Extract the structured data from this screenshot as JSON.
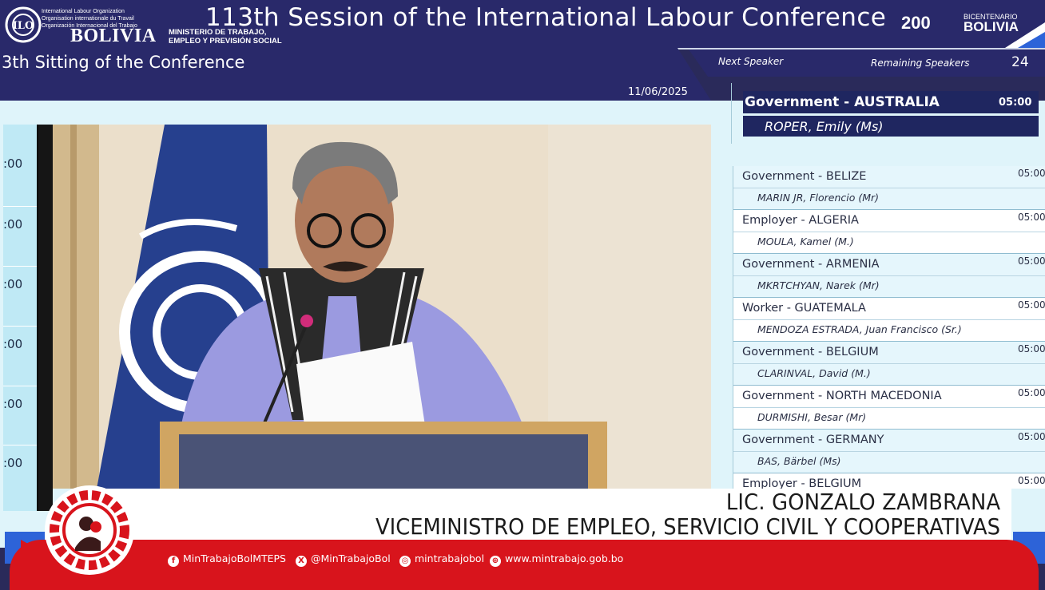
{
  "header": {
    "ilo_lines": [
      "International Labour Organization",
      "Organisation internationale du Travail",
      "Organización Internacional del Trabajo"
    ],
    "country_word": "BOLIVIA",
    "ministry_lines": [
      "MINISTERIO DE TRABAJO,",
      "EMPLEO Y PREVISIÓN SOCIAL"
    ],
    "conference_title": "113th Session of the International Labour Conference",
    "bicentenario_number": "200",
    "bicentenario_small": "BICENTENARIO",
    "bicentenario_big": "BOLIVIA"
  },
  "sitting": {
    "title": "3th Sitting of the Conference",
    "date": "11/06/2025"
  },
  "speakers_panel": {
    "next_label": "Next Speaker",
    "remaining_label": "Remaining Speakers",
    "remaining_count": "24",
    "next": {
      "country": "Government - AUSTRALIA",
      "time": "05:00",
      "name": "ROPER, Emily (Ms)"
    },
    "list": [
      {
        "country": "Government - BELIZE",
        "name": "MARIN JR, Florencio (Mr)",
        "time": "05:00"
      },
      {
        "country": "Employer - ALGERIA",
        "name": "MOULA, Kamel (M.)",
        "time": "05:00"
      },
      {
        "country": "Government - ARMENIA",
        "name": "MKRTCHYAN, Narek (Mr)",
        "time": "05:00"
      },
      {
        "country": "Worker - GUATEMALA",
        "name": "MENDOZA ESTRADA, Juan Francisco (Sr.)",
        "time": "05:00"
      },
      {
        "country": "Government - BELGIUM",
        "name": "CLARINVAL, David (M.)",
        "time": "05:00"
      },
      {
        "country": "Government - NORTH MACEDONIA",
        "name": "DURMISHI, Besar (Mr)",
        "time": "05:00"
      },
      {
        "country": "Government - GERMANY",
        "name": "BAS, Bärbel (Ms)",
        "time": "05:00"
      },
      {
        "country": "Employer - BELGIUM",
        "name": "",
        "time": "05:00"
      }
    ]
  },
  "left_strip_times": [
    ":00",
    ":00",
    ":00",
    ":00",
    ":00",
    ":00"
  ],
  "lower_third": {
    "name": "LIC. GONZALO ZAMBRANA",
    "role": "VICEMINISTRO DE EMPLEO, SERVICIO CIVIL Y COOPERATIVAS"
  },
  "social": {
    "facebook": "MinTrabajoBolMTEPS",
    "x": "@MinTrabajoBol",
    "instagram": "mintrabajobol",
    "web": "www.mintrabajo.gob.bo"
  },
  "colors": {
    "navy": "#29296a",
    "accent_red": "#d8141c",
    "list_row": "#e5f6fc"
  }
}
